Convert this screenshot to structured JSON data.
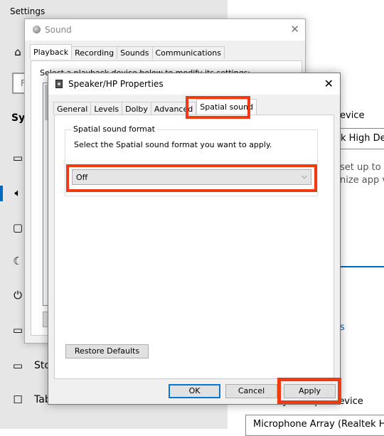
{
  "settings": {
    "title": "Settings",
    "search_placeholder_fragment": "F",
    "section_heading": "Sys",
    "nav_icons": [
      "home-icon",
      "display-icon",
      "sound-icon",
      "notifications-icon",
      "focus-assist-icon",
      "power-icon",
      "battery-icon",
      "storage-icon",
      "tablet-icon"
    ],
    "nav_items": [
      {
        "label": "Sto",
        "icon": "storage-icon"
      },
      {
        "label": "Tab",
        "icon": "tablet-icon"
      }
    ],
    "right": {
      "output_device_label_fragment": "evice",
      "output_device_value_fragment": "k High Def",
      "desc_line1_fragment": "set up to u",
      "desc_line2_fragment": "nize app vo",
      "link_fragment": "s",
      "input_device_label_fragment": "Choose your input device",
      "input_device_value": "Microphone Array (Realtek Hig"
    }
  },
  "sound_window": {
    "title": "Sound",
    "tabs": [
      "Playback",
      "Recording",
      "Sounds",
      "Communications"
    ],
    "active_tab": "Playback",
    "instruction_fragment": "Select a playback device below to modify its settings:"
  },
  "properties_dialog": {
    "title": "Speaker/HP Properties",
    "tabs": [
      "General",
      "Levels",
      "Dolby",
      "Advanced",
      "Spatial sound"
    ],
    "active_tab": "Spatial sound",
    "group_title": "Spatial sound format",
    "group_description": "Select the Spatial sound format you want to apply.",
    "format_dropdown": {
      "selected": "Off"
    },
    "restore_defaults": "Restore Defaults",
    "buttons": {
      "ok": "OK",
      "cancel": "Cancel",
      "apply": "Apply"
    },
    "highlight_color": "#f23a12"
  }
}
